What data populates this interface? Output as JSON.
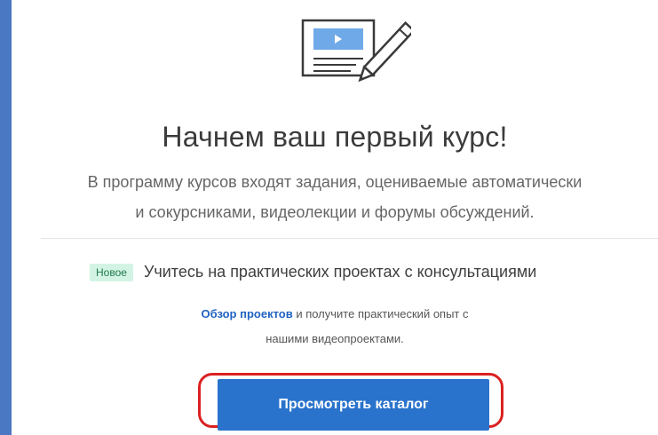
{
  "empty_state": {
    "illustration_icon": "video-lesson-document-with-pencil-icon",
    "headline": "Начнем ваш первый курс!",
    "description_line1": "В программу курсов входят задания, оцениваемые автоматически",
    "description_line2": "и сокурсниками, видеолекции и форумы обсуждений."
  },
  "promo": {
    "badge": "Новое",
    "title": "Учитесь на практических проектах с консультациями",
    "link_text": "Обзор проектов",
    "text_after_link": " и получите практический опыт с",
    "text_line2": "нашими видеопроектами."
  },
  "cta": {
    "label": "Просмотреть каталог"
  },
  "colors": {
    "primary": "#2a73cc",
    "badge_bg": "#d3f4e4",
    "highlight_outline": "#dc2020",
    "frame": "#4a78c2"
  }
}
